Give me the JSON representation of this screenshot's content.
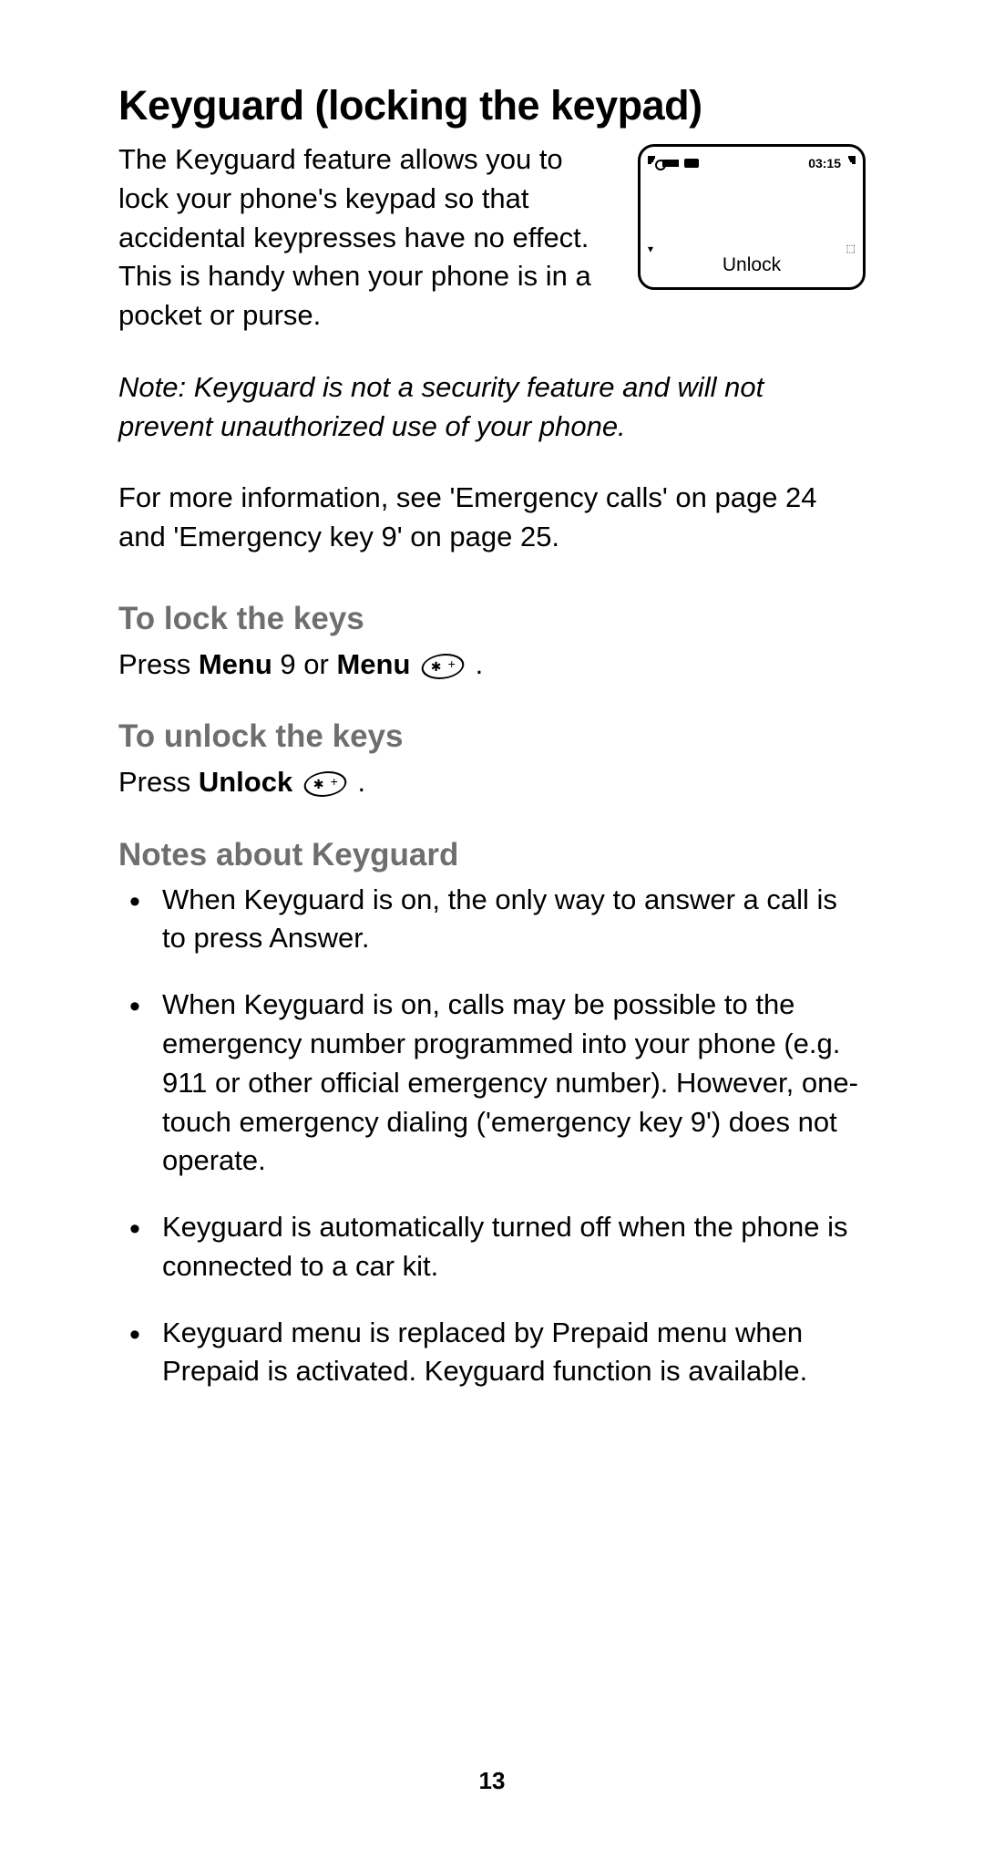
{
  "title": "Keyguard (locking the keypad)",
  "intro": "The Keyguard feature allows you to lock your phone's keypad so that accidental keypresses have no effect. This is handy when your phone is in a pocket or purse.",
  "phone": {
    "time": "03:15",
    "softkey": "Unlock"
  },
  "note": "Note:  Keyguard is not a security feature and will not prevent unauthorized use of your phone.",
  "more_info": "For more information, see 'Emergency calls' on page 24 and 'Emergency key 9' on page 25.",
  "sections": {
    "lock": {
      "heading": "To lock the keys",
      "press": "Press ",
      "menu1": "Menu",
      "between": " 9 or ",
      "menu2": "Menu",
      "period": " ."
    },
    "unlock": {
      "heading": "To unlock the keys",
      "press": "Press ",
      "unlock_word": "Unlock",
      "period": " ."
    },
    "notes": {
      "heading": "Notes about Keyguard",
      "items": [
        {
          "pre": "When Keyguard is on, the only way to answer a call is to press ",
          "bold": "Answer",
          "post": "."
        },
        {
          "text": "When Keyguard is on, calls may be possible to the emergency number programmed into your phone (e.g. 911 or other official emergency number). However, one-touch emergency dialing ('emergency key 9') does not operate."
        },
        {
          "text": "Keyguard is automatically turned off when the phone is connected to a car kit."
        },
        {
          "text": "Keyguard menu is replaced by Prepaid menu when Prepaid is activated. Keyguard function is available."
        }
      ]
    }
  },
  "page_number": "13"
}
